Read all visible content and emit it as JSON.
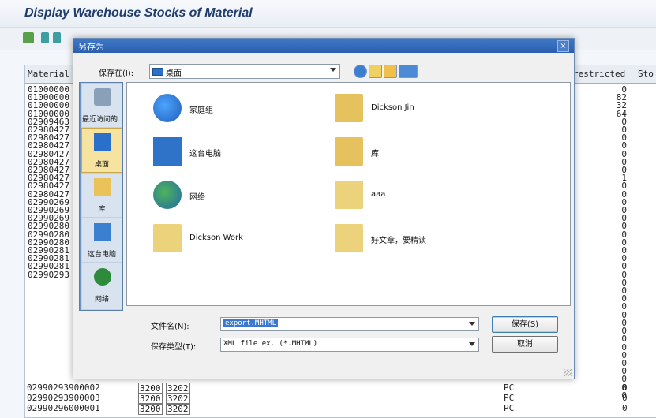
{
  "sap": {
    "title": "Display Warehouse Stocks of Material",
    "headers": {
      "material": "Material",
      "unrestricted": "restricted",
      "stock": "Sto"
    },
    "materials_text": "01000000\n01000000\n01000000\n01000000\n02909463\n02980427\n02980427\n02980427\n02980427\n02980427\n02980427\n02980427\n02980427\n02980427\n02990269\n02990269\n02990269\n02990280\n02990280\n02990280\n02990281\n02990281\n02990281\n02990293",
    "values_text": "0\n82\n32\n64\n0\n0\n0\n0\n0\n0\n0\n1\n0\n0\n0\n0\n0\n0\n0\n0\n0\n0\n0\n0\n0\n0\n0\n0\n0\n0\n0\n0\n0\n0\n0\n0\n0\n0\n0",
    "bottom_rows": [
      {
        "material": "02990293900002",
        "plant": "3200",
        "sloc": "3202",
        "unit": "PC",
        "value": "0"
      },
      {
        "material": "02990293900003",
        "plant": "3200",
        "sloc": "3202",
        "unit": "PC",
        "value": "0"
      },
      {
        "material": "02990296000001",
        "plant": "3200",
        "sloc": "3202",
        "unit": "PC",
        "value": "0"
      }
    ]
  },
  "dialog": {
    "title": "另存为",
    "save_in_label": "保存在(I):",
    "save_in_value": "桌面",
    "places": [
      "最近访问的...",
      "桌面",
      "库",
      "这台电脑",
      "网络"
    ],
    "items": [
      "家庭组",
      "Dickson Jin",
      "这台电脑",
      "库",
      "网络",
      "aaa",
      "Dickson Work",
      "好文章，要精读"
    ],
    "filename_label": "文件名(N):",
    "filename_value": "export.MHTML",
    "filetype_label": "保存类型(T):",
    "filetype_value": "XML file ex. (*.MHTML)",
    "save_button": "保存(S)",
    "cancel_button": "取消",
    "close_glyph": "×"
  },
  "colors": {
    "accent": "#2b5fad",
    "selected_place": "#f6e3a0",
    "places_bg": "#6f96c2"
  }
}
